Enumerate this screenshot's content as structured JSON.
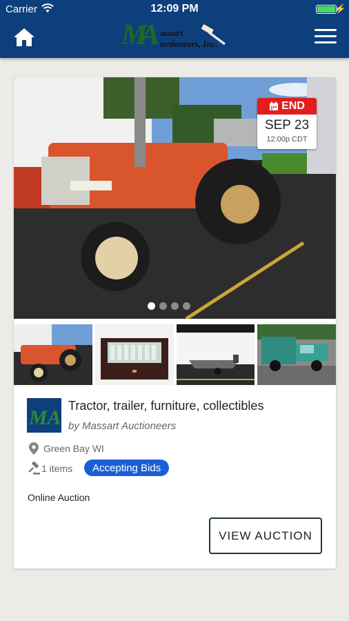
{
  "status_bar": {
    "carrier": "Carrier",
    "time": "12:09 PM",
    "battery_level": 1.0
  },
  "header": {
    "home_icon": "home-icon",
    "menu_icon": "hamburger-menu-icon",
    "logo": {
      "letters": "MA",
      "line1": "assart",
      "line2": "uctioneers, Inc."
    },
    "background_color": "#0d3f7c"
  },
  "auction": {
    "end_badge": {
      "label": "END",
      "date": "SEP 23",
      "time": "12:00p CDT",
      "color": "#e21d1d"
    },
    "carousel": {
      "slide_count": 4,
      "active_index": 0
    },
    "thumbnails": [
      {
        "subject": "tractor"
      },
      {
        "subject": "display case"
      },
      {
        "subject": "boat on trailer"
      },
      {
        "subject": "green truck"
      }
    ],
    "org_logo_letters": "MA",
    "title": "Tractor, trailer, furniture, collectibles",
    "byline": "by Massart Auctioneers",
    "location": "Green Bay WI",
    "items": "1 items",
    "status": "Accepting Bids",
    "status_color": "#1a5fd6",
    "type": "Online Auction",
    "view_button": "VIEW AUCTION"
  }
}
